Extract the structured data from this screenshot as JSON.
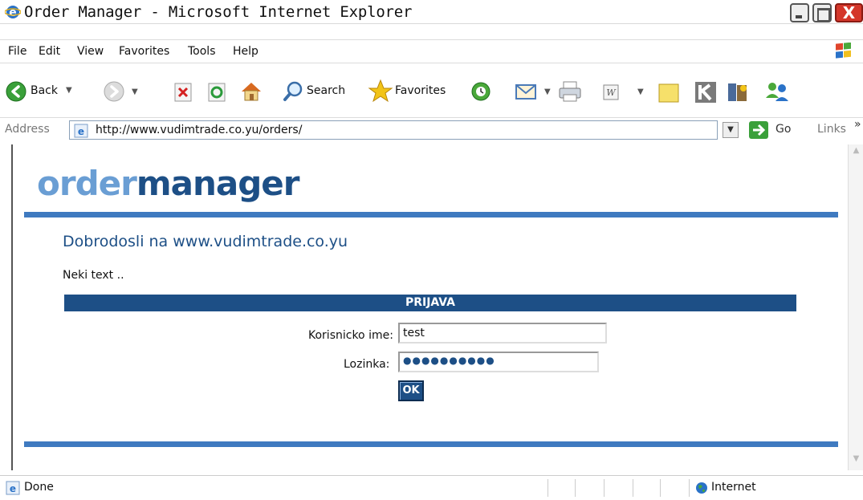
{
  "window": {
    "title": "Order Manager - Microsoft Internet Explorer",
    "close_glyph": "X"
  },
  "menu": {
    "items": [
      "File",
      "Edit",
      "View",
      "Favorites",
      "Tools",
      "Help"
    ]
  },
  "toolbar": {
    "back_label": "Back",
    "search_label": "Search",
    "favorites_label": "Favorites"
  },
  "address": {
    "label": "Address",
    "url": "http://www.vudimtrade.co.yu/orders/",
    "go_label": "Go",
    "links_label": "Links",
    "links_close": "»"
  },
  "page": {
    "logo_part1": "order",
    "logo_part2": "manager",
    "welcome": "Dobrodosli na www.vudimtrade.co.yu",
    "intro": "Neki text ..",
    "login_header": "PRIJAVA",
    "username_label": "Korisnicko ime:",
    "username_value": "test",
    "password_label": "Lozinka:",
    "password_masked": "●●●●●●●●●●",
    "ok_label": "OK"
  },
  "status": {
    "text": "Done",
    "zone": "Internet"
  },
  "colors": {
    "brand_dark": "#1d4f86",
    "brand_light": "#6a9ed4",
    "rule": "#3f7ac0"
  }
}
